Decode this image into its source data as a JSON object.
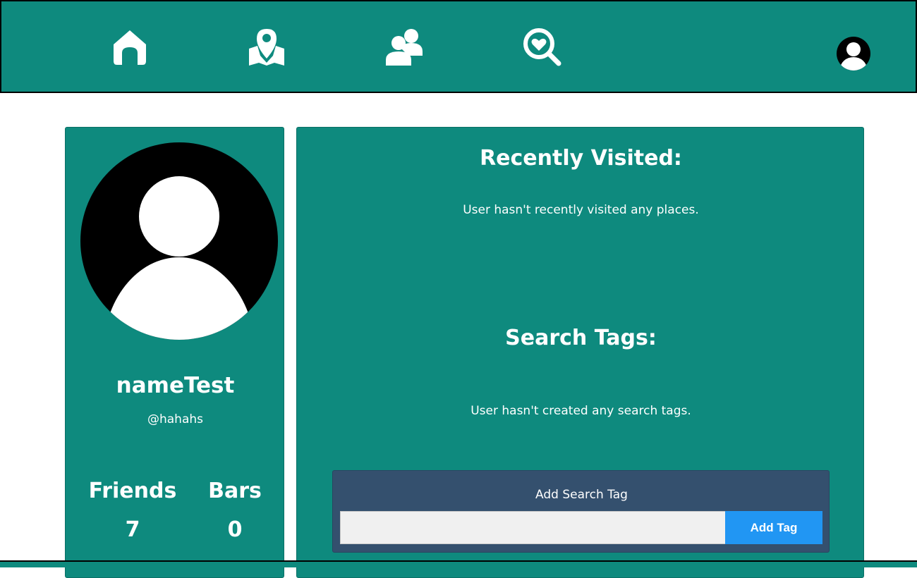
{
  "nav": {
    "items": [
      {
        "icon": "home-icon"
      },
      {
        "icon": "map-pin-icon"
      },
      {
        "icon": "users-icon"
      },
      {
        "icon": "search-heart-icon"
      }
    ],
    "account_icon": "user-avatar-icon"
  },
  "profile": {
    "display_name": "nameTest",
    "handle": "@hahahs",
    "stats": {
      "friends_label": "Friends",
      "friends_value": "7",
      "bars_label": "Bars",
      "bars_value": "0"
    }
  },
  "main": {
    "recent_title": "Recently Visited:",
    "recent_empty": "User hasn't recently visited any places.",
    "tags_title": "Search Tags:",
    "tags_empty": "User hasn't created any search tags.",
    "add_tag": {
      "title": "Add Search Tag",
      "input_value": "",
      "input_placeholder": "",
      "button_label": "Add Tag"
    }
  },
  "colors": {
    "teal": "#0e8a7e",
    "panel": "#34506e",
    "button": "#2196f3"
  }
}
